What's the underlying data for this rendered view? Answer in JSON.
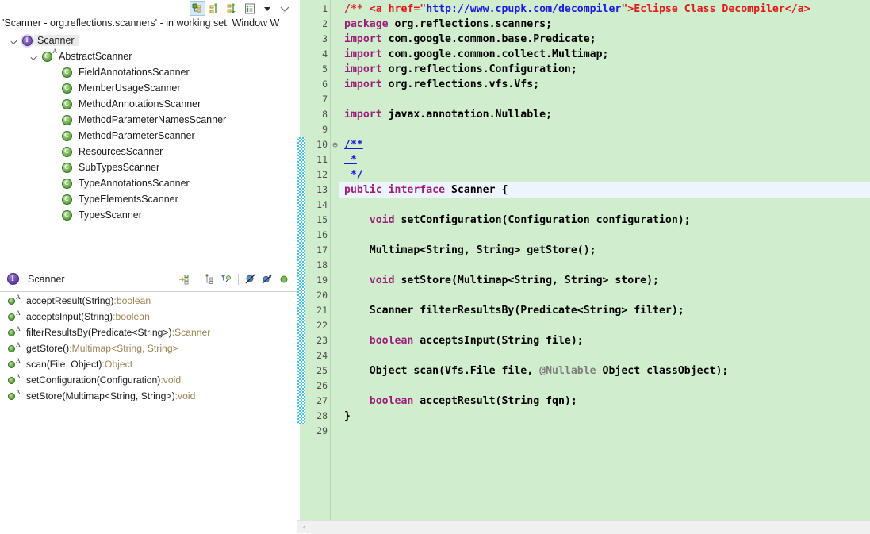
{
  "hierarchy_view": {
    "toolbar": [
      {
        "name": "type-hierarchy-icon",
        "label": "Type Hierarchy",
        "selected": true
      },
      {
        "name": "supertype-hierarchy-icon",
        "label": "Supertype Hierarchy",
        "selected": false
      },
      {
        "name": "subtype-hierarchy-icon",
        "label": "Subtype Hierarchy",
        "selected": false
      },
      {
        "name": "member-list-icon",
        "label": "Show Members",
        "selected": false
      },
      {
        "name": "chevron-down-icon",
        "label": "View Menu",
        "selected": false
      },
      {
        "name": "minimize-icon",
        "label": "Minimize",
        "selected": false
      }
    ],
    "description": "'Scanner - org.reflections.scanners' - in working set: Window W",
    "tree": [
      {
        "label": "Scanner",
        "icon": "interface-icon",
        "depth": 0,
        "twisty": "open",
        "selected": true,
        "abstract": false
      },
      {
        "label": "AbstractScanner",
        "icon": "class-icon",
        "depth": 1,
        "twisty": "open",
        "selected": false,
        "abstract": true
      },
      {
        "label": "FieldAnnotationsScanner",
        "icon": "class-icon",
        "depth": 2,
        "twisty": "none",
        "selected": false,
        "abstract": false
      },
      {
        "label": "MemberUsageScanner",
        "icon": "class-icon",
        "depth": 2,
        "twisty": "none",
        "selected": false,
        "abstract": false
      },
      {
        "label": "MethodAnnotationsScanner",
        "icon": "class-icon",
        "depth": 2,
        "twisty": "none",
        "selected": false,
        "abstract": false
      },
      {
        "label": "MethodParameterNamesScanner",
        "icon": "class-icon",
        "depth": 2,
        "twisty": "none",
        "selected": false,
        "abstract": false
      },
      {
        "label": "MethodParameterScanner",
        "icon": "class-icon",
        "depth": 2,
        "twisty": "none",
        "selected": false,
        "abstract": false
      },
      {
        "label": "ResourcesScanner",
        "icon": "class-icon",
        "depth": 2,
        "twisty": "none",
        "selected": false,
        "abstract": false
      },
      {
        "label": "SubTypesScanner",
        "icon": "class-icon",
        "depth": 2,
        "twisty": "none",
        "selected": false,
        "abstract": false
      },
      {
        "label": "TypeAnnotationsScanner",
        "icon": "class-icon",
        "depth": 2,
        "twisty": "none",
        "selected": false,
        "abstract": false
      },
      {
        "label": "TypeElementsScanner",
        "icon": "class-icon",
        "depth": 2,
        "twisty": "none",
        "selected": false,
        "abstract": false
      },
      {
        "label": "TypesScanner",
        "icon": "class-icon",
        "depth": 2,
        "twisty": "none",
        "selected": false,
        "abstract": false
      }
    ]
  },
  "outline_view": {
    "title": "Scanner",
    "title_icon": "interface-icon",
    "toolbar": [
      {
        "name": "focus-on-selection-icon",
        "label": "Focus On Selection"
      },
      {
        "name": "sort-icon",
        "label": "Sort"
      },
      {
        "name": "filter-icon",
        "label": "Filters"
      },
      {
        "name": "hide-fields-icon",
        "label": "Hide Fields"
      },
      {
        "name": "hide-static-icon",
        "label": "Hide Static Members"
      },
      {
        "name": "hide-nonpublic-icon",
        "label": "Hide Non-Public Members"
      }
    ],
    "members": [
      {
        "name": "acceptResult(String)",
        "separator": " : ",
        "type": "boolean",
        "abstract": true
      },
      {
        "name": "acceptsInput(String)",
        "separator": " : ",
        "type": "boolean",
        "abstract": true
      },
      {
        "name": "filterResultsBy(Predicate<String>)",
        "separator": " : ",
        "type": "Scanner",
        "abstract": true
      },
      {
        "name": "getStore()",
        "separator": " : ",
        "type": "Multimap<String, String>",
        "abstract": true
      },
      {
        "name": "scan(File, Object)",
        "separator": " : ",
        "type": "Object",
        "abstract": true
      },
      {
        "name": "setConfiguration(Configuration)",
        "separator": " : ",
        "type": "void",
        "abstract": true
      },
      {
        "name": "setStore(Multimap<String, String>)",
        "separator": " : ",
        "type": "void",
        "abstract": true
      }
    ]
  },
  "editor": {
    "current_line": 13,
    "fold_lines": [
      10
    ],
    "changed_range": [
      10,
      28
    ],
    "lines": [
      {
        "n": 1,
        "segments": [
          {
            "t": "/** <a href=\"",
            "c": "cmt"
          },
          {
            "t": "http://www.cpupk.com/decompiler",
            "c": "lnk"
          },
          {
            "t": "\">Eclipse Class Decompiler</a> ",
            "c": "cmt"
          }
        ]
      },
      {
        "n": 2,
        "segments": [
          {
            "t": "package ",
            "c": "kw"
          },
          {
            "t": "org.reflections.scanners;",
            "c": "plain"
          }
        ]
      },
      {
        "n": 3,
        "segments": [
          {
            "t": "import ",
            "c": "kw"
          },
          {
            "t": "com.google.common.base.Predicate;",
            "c": "plain"
          }
        ]
      },
      {
        "n": 4,
        "segments": [
          {
            "t": "import ",
            "c": "kw"
          },
          {
            "t": "com.google.common.collect.Multimap;",
            "c": "plain"
          }
        ]
      },
      {
        "n": 5,
        "segments": [
          {
            "t": "import ",
            "c": "kw"
          },
          {
            "t": "org.reflections.Configuration;",
            "c": "plain"
          }
        ]
      },
      {
        "n": 6,
        "segments": [
          {
            "t": "import ",
            "c": "kw"
          },
          {
            "t": "org.reflections.vfs.Vfs;",
            "c": "plain"
          }
        ]
      },
      {
        "n": 7,
        "segments": []
      },
      {
        "n": 8,
        "segments": [
          {
            "t": "import ",
            "c": "kw"
          },
          {
            "t": "javax.annotation.Nullable;",
            "c": "plain"
          }
        ]
      },
      {
        "n": 9,
        "segments": []
      },
      {
        "n": 10,
        "segments": [
          {
            "t": "/**",
            "c": "lnk"
          }
        ]
      },
      {
        "n": 11,
        "segments": [
          {
            "t": " *",
            "c": "lnk"
          }
        ]
      },
      {
        "n": 12,
        "segments": [
          {
            "t": " */",
            "c": "lnk"
          }
        ]
      },
      {
        "n": 13,
        "segments": [
          {
            "t": "public interface ",
            "c": "kw"
          },
          {
            "t": "Scanner {",
            "c": "plain"
          }
        ]
      },
      {
        "n": 14,
        "segments": []
      },
      {
        "n": 15,
        "segments": [
          {
            "t": "    ",
            "c": "plain"
          },
          {
            "t": "void",
            "c": "kw"
          },
          {
            "t": " setConfiguration(Configuration configuration);",
            "c": "plain"
          }
        ]
      },
      {
        "n": 16,
        "segments": []
      },
      {
        "n": 17,
        "segments": [
          {
            "t": "    Multimap<String, String> getStore();",
            "c": "plain"
          }
        ]
      },
      {
        "n": 18,
        "segments": []
      },
      {
        "n": 19,
        "segments": [
          {
            "t": "    ",
            "c": "plain"
          },
          {
            "t": "void",
            "c": "kw"
          },
          {
            "t": " setStore(Multimap<String, String> store);",
            "c": "plain"
          }
        ]
      },
      {
        "n": 20,
        "segments": []
      },
      {
        "n": 21,
        "segments": [
          {
            "t": "    Scanner filterResultsBy(Predicate<String> filter);",
            "c": "plain"
          }
        ]
      },
      {
        "n": 22,
        "segments": []
      },
      {
        "n": 23,
        "segments": [
          {
            "t": "    ",
            "c": "plain"
          },
          {
            "t": "boolean",
            "c": "kw"
          },
          {
            "t": " acceptsInput(String file);",
            "c": "plain"
          }
        ]
      },
      {
        "n": 24,
        "segments": []
      },
      {
        "n": 25,
        "segments": [
          {
            "t": "    Object scan(Vfs.File file, ",
            "c": "plain"
          },
          {
            "t": "@Nullable",
            "c": "ann"
          },
          {
            "t": " Object classObject);",
            "c": "plain"
          }
        ]
      },
      {
        "n": 26,
        "segments": []
      },
      {
        "n": 27,
        "segments": [
          {
            "t": "    ",
            "c": "plain"
          },
          {
            "t": "boolean",
            "c": "kw"
          },
          {
            "t": " acceptResult(String fqn);",
            "c": "plain"
          }
        ]
      },
      {
        "n": 28,
        "segments": [
          {
            "t": "}",
            "c": "plain"
          }
        ]
      },
      {
        "n": 29,
        "segments": []
      }
    ]
  },
  "scrollbar": {
    "left_arrow": "‹"
  },
  "colors": {
    "editor_background": "#d0edcd",
    "current_line": "#eef4fb",
    "keyword": "#9b1d7a",
    "comment": "#e01b1b",
    "link": "#1a1ae0",
    "annotation": "#7d7d7d",
    "change_bar": "#49c2e8"
  }
}
